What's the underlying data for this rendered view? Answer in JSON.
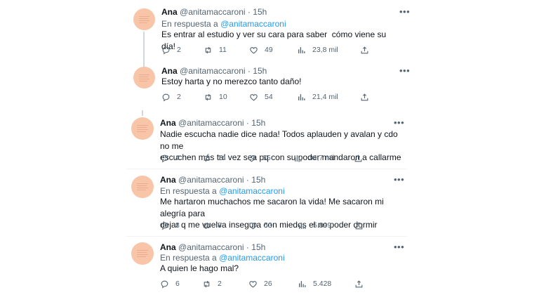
{
  "tweets": [
    {
      "name": "Ana",
      "handle": "@anitamaccaroni",
      "separator": "·",
      "time": "15h",
      "reply_prefix": "En respuesta a",
      "reply_to": "@anitamaccaroni",
      "text": "Es entrar al estudio y ver su cara para saber  cómo viene su día!",
      "replies": "2",
      "retweets": "11",
      "likes": "49",
      "views": "23,8 mil"
    },
    {
      "name": "Ana",
      "handle": "@anitamaccaroni",
      "separator": "·",
      "time": "15h",
      "text": "Estoy harta y no merezco tanto daño!",
      "replies": "2",
      "retweets": "10",
      "likes": "54",
      "views": "21,4 mil"
    },
    {
      "name": "Ana",
      "handle": "@anitamaccaroni",
      "separator": "·",
      "time": "15h",
      "text": "Nadie escucha nadie dice nada! Todos aplauden y avalan y cdo no me\nescuchen más tal vez sea pq con su poder mandaron a callarme",
      "replies": "4",
      "retweets": "14",
      "likes": "65",
      "views": "34,7 mil"
    },
    {
      "name": "Ana",
      "handle": "@anitamaccaroni",
      "separator": "·",
      "time": "15h",
      "reply_prefix": "En respuesta a",
      "reply_to": "@anitamaccaroni",
      "text": "Me hartaron muchachos me sacaron la vida! Me sacaron mi alegría para\ndejar q me vuelva insegura con miedos el no poder dormir",
      "replies": "3",
      "retweets": "8",
      "likes": "53",
      "views": "5.899"
    },
    {
      "name": "Ana",
      "handle": "@anitamaccaroni",
      "separator": "·",
      "time": "15h",
      "reply_prefix": "En respuesta a",
      "reply_to": "@anitamaccaroni",
      "text": "A quien le hago mal?",
      "replies": "6",
      "retweets": "2",
      "likes": "26",
      "views": "5.428"
    }
  ],
  "icons": {
    "more": "more-icon",
    "reply": "reply-icon",
    "retweet": "retweet-icon",
    "like": "like-icon",
    "views": "views-icon",
    "share": "share-icon"
  },
  "colors": {
    "mention": "#1d9bf0",
    "secondary_text": "#536471",
    "avatar": "#f8c5a8",
    "thread_line": "#cfd9de"
  }
}
